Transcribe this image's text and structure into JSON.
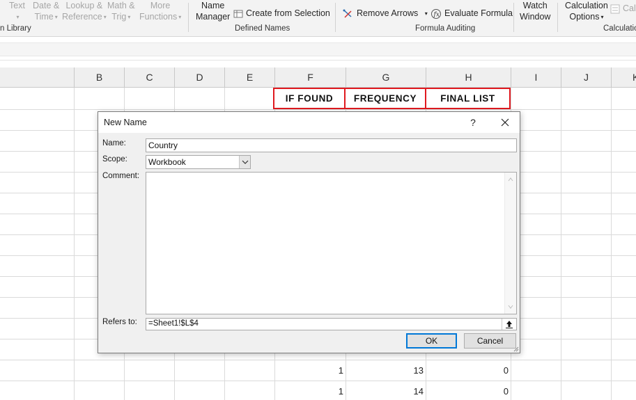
{
  "ribbon": {
    "function_library": {
      "text_label": "Text",
      "datetime_line1": "Date &",
      "datetime_line2": "Time",
      "lookup_line1": "Lookup &",
      "lookup_line2": "Reference",
      "math_line1": "Math &",
      "math_line2": "Trig",
      "more_line1": "More",
      "more_line2": "Functions",
      "group_label": "n Library"
    },
    "defined_names": {
      "name_manager_line1": "Name",
      "name_manager_line2": "Manager",
      "create_from_selection": "Create from Selection",
      "group_label": "Defined Names"
    },
    "formula_auditing": {
      "remove_arrows": "Remove Arrows",
      "evaluate_formula": "Evaluate Formula",
      "watch_window_line1": "Watch",
      "watch_window_line2": "Window",
      "group_label": "Formula Auditing"
    },
    "calculation": {
      "calc_options_line1": "Calculation",
      "calc_options_line2": "Options",
      "calc_now_partial": "Cal",
      "group_label": "Calculatio"
    }
  },
  "sheet": {
    "columns": [
      "B",
      "C",
      "D",
      "E",
      "F",
      "G",
      "H",
      "I",
      "J",
      "K"
    ],
    "header_cells": {
      "f": "IF  FOUND",
      "g": "FREQUENCY",
      "h": "FINAL  LIST"
    },
    "rows": [
      {
        "f": "1",
        "g": "13",
        "h": "0"
      },
      {
        "f": "1",
        "g": "14",
        "h": "0"
      }
    ]
  },
  "dialog": {
    "title": "New Name",
    "help_symbol": "?",
    "name_label": "Name:",
    "name_value": "Country",
    "scope_label": "Scope:",
    "scope_value": "Workbook",
    "comment_label": "Comment:",
    "refers_label": "Refers to:",
    "refers_value": "=Sheet1!$L$4",
    "ok_label": "OK",
    "cancel_label": "Cancel"
  },
  "colors": {
    "header_border": "#e0191f",
    "ok_focus": "#0078d7",
    "dialog_bg": "#f0f0f0",
    "ribbon_bg": "#f3f3f3"
  },
  "icons": [
    "remove-arrows-icon",
    "evaluate-formula-icon",
    "create-from-selection-icon",
    "close-icon",
    "chevron-down-icon",
    "collapse-dialog-icon",
    "resize-grip-icon"
  ]
}
